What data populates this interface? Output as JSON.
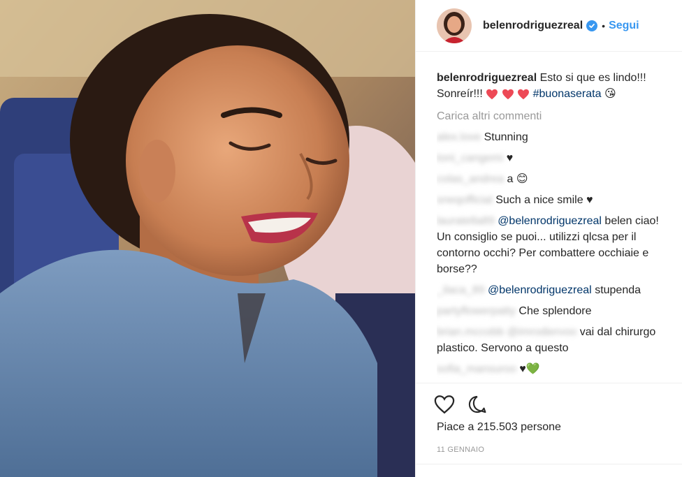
{
  "post": {
    "username": "belenrodriguezreal",
    "follow_label": "Segui",
    "dot": "•",
    "caption": {
      "username": "belenrodriguezreal",
      "text": "Esto si que es lindo!!! Sonreír!!!",
      "hashtag": "#buonaserata"
    },
    "load_more_label": "Carica altri commenti",
    "comments": [
      {
        "user": "alex.love",
        "text": "Stunning"
      },
      {
        "user": "toni_cangemi",
        "text": "♥"
      },
      {
        "user": "colas_andrea",
        "text": "a 😊"
      },
      {
        "user": "sneqofficial",
        "text": "Such a nice smile ♥"
      },
      {
        "user": "lauratella89",
        "mention": "@belenrodriguezreal",
        "text": "belen ciao! Un consiglio se puoi... utilizzi qlcsa per il contorno occhi? Per combattere occhiaie e borse??"
      },
      {
        "user": "_ilaca_89",
        "mention": "@belenrodriguezreal",
        "text": "stupenda"
      },
      {
        "user": "partyflowerpatty",
        "text": "Che splendore"
      },
      {
        "user": "brian.mccobb",
        "mention": "@imrodiervoo",
        "text": "vai dal chirurgo plastico. Servono a questo"
      },
      {
        "user": "sofia_mansuroo",
        "text": "♥💚"
      }
    ],
    "likes_text": "Piace a 215.503 persone",
    "date": "11 GENNAIO"
  },
  "colors": {
    "accent": "#3897f0",
    "heart_red": "#ed4956",
    "hashtag": "#003569",
    "muted": "#999999"
  },
  "icons": {
    "verified": "verified-badge-icon",
    "like": "heart-outline-icon",
    "comment": "comment-bubble-icon"
  }
}
